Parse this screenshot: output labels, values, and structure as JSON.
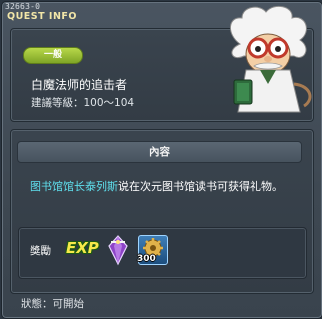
{
  "quest_id": "32663-0",
  "window_title": "QUEST INFO",
  "badge": "一般",
  "quest_name": "白魔法师的追击者",
  "level": {
    "label": "建議等級：",
    "value": "100～104"
  },
  "content_header": "內容",
  "description": {
    "npc": "图书馆馆长泰列斯",
    "text": "说在次元图书馆读书可获得礼物。"
  },
  "reward": {
    "label": "獎勵",
    "exp": "EXP",
    "item_count": "300"
  },
  "status": {
    "label": "狀態：",
    "value": "可開始"
  }
}
